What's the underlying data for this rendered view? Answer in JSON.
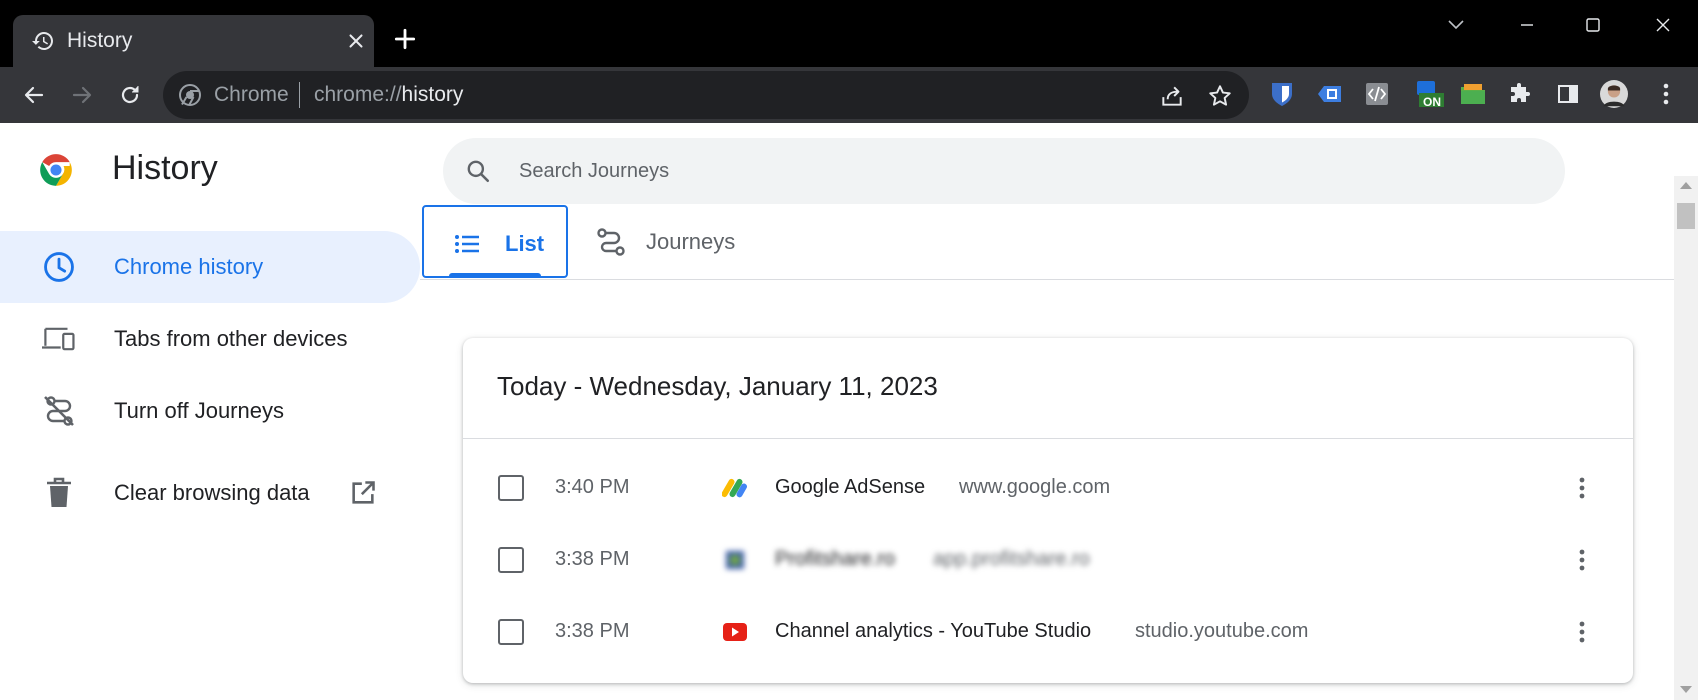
{
  "browser": {
    "tab_title": "History",
    "omnibox": {
      "chip": "Chrome",
      "url_scheme": "chrome://",
      "url_path": "history"
    },
    "extensions": [
      "bitwarden-icon",
      "bookmark-ext-icon",
      "code-ext-icon",
      "on-ext-icon",
      "folder-ext-icon",
      "puzzle-icon",
      "side-panel-icon",
      "avatar"
    ],
    "extension_badge": "ON"
  },
  "page": {
    "title": "History",
    "search_placeholder": "Search Journeys"
  },
  "sidebar": {
    "items": [
      {
        "label": "Chrome history",
        "icon": "clock-icon",
        "active": true
      },
      {
        "label": "Tabs from other devices",
        "icon": "devices-icon",
        "active": false
      },
      {
        "label": "Turn off Journeys",
        "icon": "journeys-off-icon",
        "active": false
      },
      {
        "label": "Clear browsing data",
        "icon": "trash-icon",
        "active": false
      }
    ]
  },
  "tabs": {
    "list": "List",
    "journeys": "Journeys"
  },
  "history": {
    "date_heading": "Today - Wednesday, January 11, 2023",
    "rows": [
      {
        "time": "3:40 PM",
        "title": "Google AdSense",
        "domain": "www.google.com",
        "favicon": "adsense-icon",
        "blurred": false
      },
      {
        "time": "3:38 PM",
        "title": "Profitshare.ro",
        "domain": "app.profitshare.ro",
        "favicon": "blurred-site-icon",
        "blurred": true
      },
      {
        "time": "3:38 PM",
        "title": "Channel analytics - YouTube Studio",
        "domain": "studio.youtube.com",
        "favicon": "youtube-icon",
        "blurred": false
      }
    ]
  },
  "colors": {
    "accent": "#1a73e8",
    "active_bg": "#e8f0fe",
    "toolbar": "#35363a",
    "titlebar": "#000000"
  }
}
